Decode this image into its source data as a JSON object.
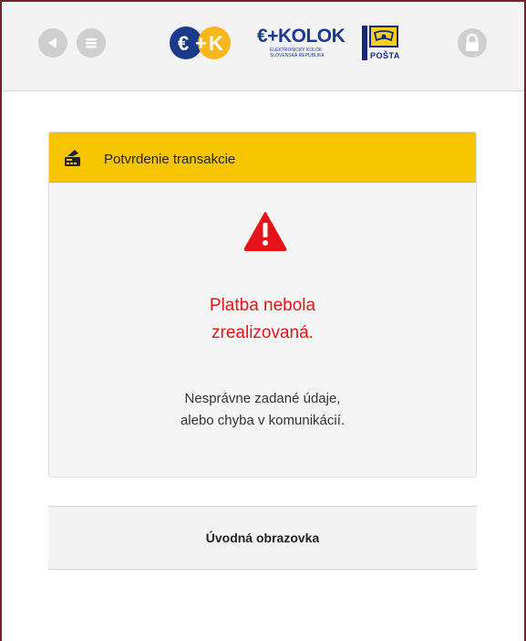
{
  "header": {
    "back_icon": "back-arrow-icon",
    "menu_icon": "menu-icon",
    "lock_icon": "lock-icon",
    "logos": {
      "ek_logo": {
        "text": "€+K",
        "colors": [
          "#1a3a8c",
          "#f8b81c"
        ]
      },
      "ekolok_logo": {
        "wordmark": "€+KOLOK",
        "subtitle_line1": "ELEKTRONICKÝ KOLOK",
        "subtitle_line2": "SLOVENSKÁ REPUBLIKA"
      },
      "posta_logo": {
        "wordmark": "POŠTA"
      }
    }
  },
  "card": {
    "title": "Potvrdenie transakcie",
    "header_icon": "card-terminal-icon",
    "status_icon": "warning-triangle-icon",
    "error_title_line1": "Platba nebola",
    "error_title_line2": "zrealizovaná.",
    "error_detail_line1": "Nesprávne zadané údaje,",
    "error_detail_line2": "alebo chyba v komunikácií."
  },
  "actions": {
    "home_label": "Úvodná obrazovka"
  },
  "colors": {
    "accent_yellow": "#f7c500",
    "error_red": "#e4141b",
    "brand_blue": "#1a3a8c",
    "border_maroon": "#7d1e2c"
  }
}
